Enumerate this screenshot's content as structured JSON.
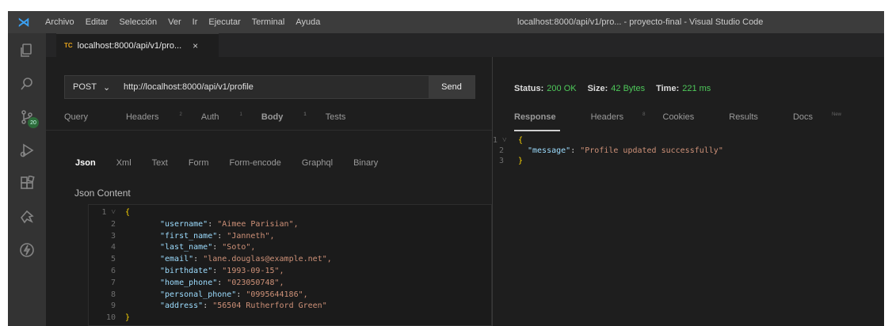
{
  "titlebar": {
    "menu": [
      "Archivo",
      "Editar",
      "Selección",
      "Ver",
      "Ir",
      "Ejecutar",
      "Terminal",
      "Ayuda"
    ],
    "window_title": "localhost:8000/api/v1/pro... - proyecto-final - Visual Studio Code"
  },
  "activity_bar": {
    "icons": [
      "explorer-icon",
      "search-icon",
      "source-control-icon",
      "run-debug-icon",
      "extensions-icon",
      "thunder-client-icon",
      "lightning-icon"
    ],
    "source_control_badge": "20"
  },
  "editor_tab": {
    "icon_text": "TC",
    "label": "localhost:8000/api/v1/pro...",
    "close": "×"
  },
  "request": {
    "method": "POST",
    "url": "http://localhost:8000/api/v1/profile",
    "send_label": "Send",
    "tabs": [
      {
        "label": "Query",
        "sup": ""
      },
      {
        "label": "Headers",
        "sup": "2"
      },
      {
        "label": "Auth",
        "sup": "1"
      },
      {
        "label": "Body",
        "sup": "1"
      },
      {
        "label": "Tests",
        "sup": ""
      }
    ],
    "active_tab": "Body",
    "body_types": [
      "Json",
      "Xml",
      "Text",
      "Form",
      "Form-encode",
      "Graphql",
      "Binary"
    ],
    "active_body_type": "Json",
    "json_content_label": "Json Content",
    "lines": [
      {
        "n": "1",
        "fold": "˅",
        "text": "{"
      },
      {
        "n": "2",
        "fold": "",
        "key": "\"username\"",
        "value": "\"Aimee Parisian\","
      },
      {
        "n": "3",
        "fold": "",
        "key": "\"first_name\"",
        "value": "\"Janneth\","
      },
      {
        "n": "4",
        "fold": "",
        "key": "\"last_name\"",
        "value": "\"Soto\","
      },
      {
        "n": "5",
        "fold": "",
        "key": "\"email\"",
        "value": "\"lane.douglas@example.net\","
      },
      {
        "n": "6",
        "fold": "",
        "key": "\"birthdate\"",
        "value": "\"1993-09-15\","
      },
      {
        "n": "7",
        "fold": "",
        "key": "\"home_phone\"",
        "value": "\"023050748\","
      },
      {
        "n": "8",
        "fold": "",
        "key": "\"personal_phone\"",
        "value": "\"0995644186\","
      },
      {
        "n": "9",
        "fold": "",
        "key": "\"address\"",
        "value": "\"56504 Rutherford Green\""
      },
      {
        "n": "10",
        "fold": "",
        "text": "}"
      }
    ]
  },
  "response": {
    "status_label": "Status:",
    "status_value": "200 OK",
    "size_label": "Size:",
    "size_value": "42 Bytes",
    "time_label": "Time:",
    "time_value": "221 ms",
    "tabs": [
      {
        "label": "Response",
        "sup": ""
      },
      {
        "label": "Headers",
        "sup": "8"
      },
      {
        "label": "Cookies",
        "sup": ""
      },
      {
        "label": "Results",
        "sup": ""
      },
      {
        "label": "Docs",
        "sup": "New"
      }
    ],
    "active_tab": "Response",
    "lines": [
      {
        "n": "1",
        "fold": "˅",
        "text": "{"
      },
      {
        "n": "2",
        "fold": "",
        "key": "\"message\"",
        "value": "\"Profile updated successfully\""
      },
      {
        "n": "3",
        "fold": "",
        "text": "}"
      }
    ]
  },
  "colors": {
    "status_green": "#4ec95a",
    "json_key": "#9cdcfe",
    "json_string": "#ce9178",
    "brace": "#ffd700"
  }
}
